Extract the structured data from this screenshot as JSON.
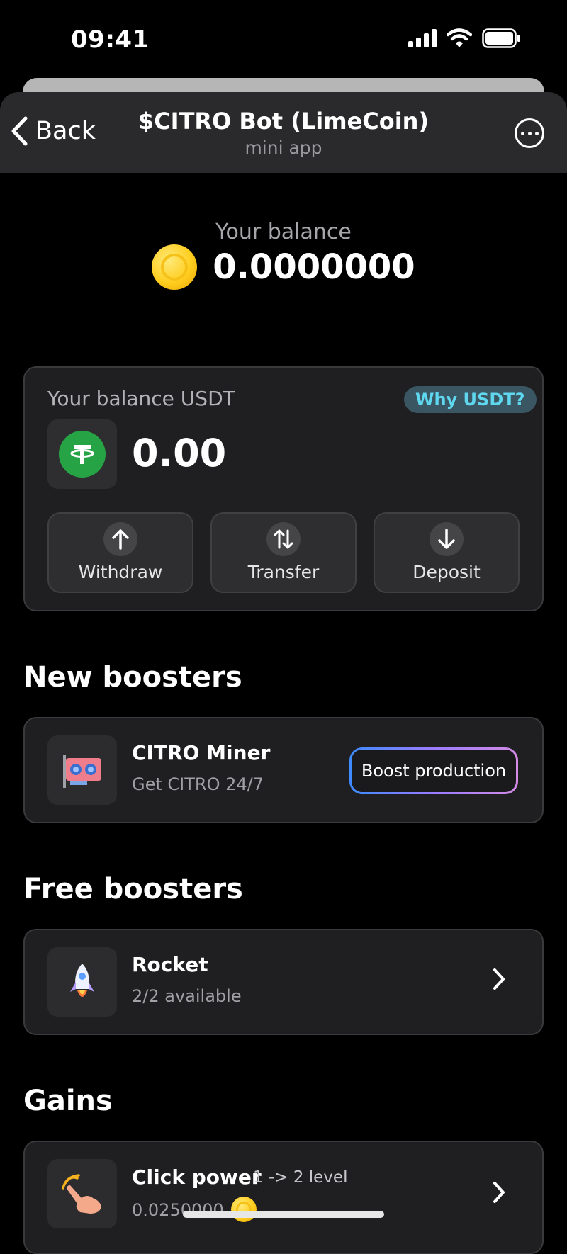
{
  "status_bar": {
    "time": "09:41"
  },
  "nav": {
    "back_label": "Back",
    "title": "$CITRO Bot (LimeCoin)",
    "subtitle": "mini app"
  },
  "balance": {
    "label": "Your balance",
    "value": "0.0000000"
  },
  "usdt_card": {
    "label": "Your balance USDT",
    "why_label": "Why USDT?",
    "value": "0.00",
    "actions": [
      {
        "label": "Withdraw",
        "icon": "arrow-up-icon"
      },
      {
        "label": "Transfer",
        "icon": "transfer-icon"
      },
      {
        "label": "Deposit",
        "icon": "arrow-down-icon"
      }
    ]
  },
  "new_boosters": {
    "title": "New boosters",
    "item": {
      "title": "CITRO Miner",
      "subtitle": "Get CITRO 24/7",
      "button_label": "Boost production",
      "icon": "gpu-icon"
    }
  },
  "free_boosters": {
    "title": "Free boosters",
    "item": {
      "title": "Rocket",
      "subtitle": "2/2 available",
      "icon": "rocket-icon"
    }
  },
  "gains": {
    "title": "Gains",
    "item": {
      "title": "Click power",
      "level": "1 -> 2 level",
      "value": "0.0250000",
      "icon": "tap-hand-icon"
    }
  },
  "colors": {
    "accent_cyan": "#5fd7ee",
    "tether_green": "#26a345",
    "coin_gold": "#ffce1f"
  }
}
